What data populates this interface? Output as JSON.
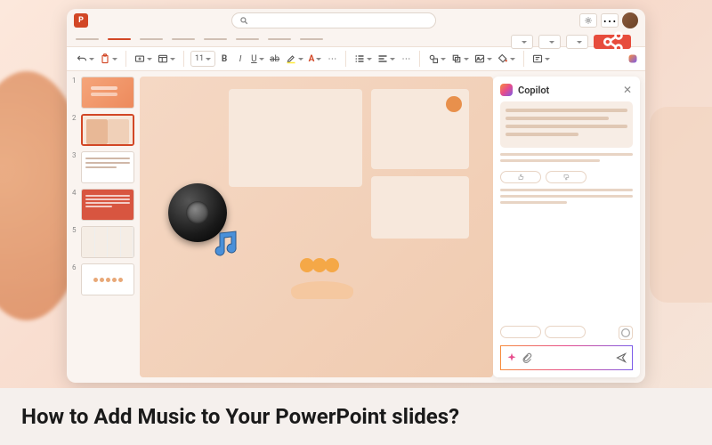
{
  "caption": "How to Add Music to Your PowerPoint slides?",
  "app": {
    "name": "PowerPoint",
    "icon_letter": "P",
    "search_placeholder": "",
    "font_size": "11"
  },
  "copilot": {
    "title": "Copilot"
  },
  "thumbnails": [
    {
      "num": "1"
    },
    {
      "num": "2"
    },
    {
      "num": "3"
    },
    {
      "num": "4"
    },
    {
      "num": "5"
    },
    {
      "num": "6"
    }
  ]
}
